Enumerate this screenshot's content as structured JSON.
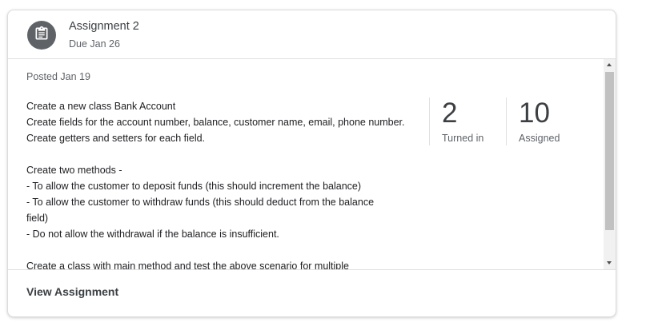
{
  "assignment": {
    "title": "Assignment 2",
    "due": "Due Jan 26",
    "posted": "Posted Jan 19",
    "icon": "assignment-icon"
  },
  "description": {
    "lines": [
      "Create a new class Bank Account",
      "Create fields for the account number, balance, customer name, email, phone number.",
      "Create getters and setters for each field.",
      "",
      "Create two methods -",
      "- To allow the customer to deposit funds (this should increment the balance)",
      "- To allow the customer to withdraw funds (this should deduct from the balance",
      "field)",
      "- Do not allow the withdrawal if the balance is insufficient.",
      "",
      "Create a class with main method and test the above scenario for multiple"
    ]
  },
  "stats": {
    "turned_in": {
      "value": "2",
      "label": "Turned in"
    },
    "assigned": {
      "value": "10",
      "label": "Assigned"
    }
  },
  "footer": {
    "view_label": "View Assignment"
  },
  "colors": {
    "avatar_bg": "#5f6368",
    "border": "#e0e0e0",
    "scroll_thumb": "#c1c1c1"
  }
}
